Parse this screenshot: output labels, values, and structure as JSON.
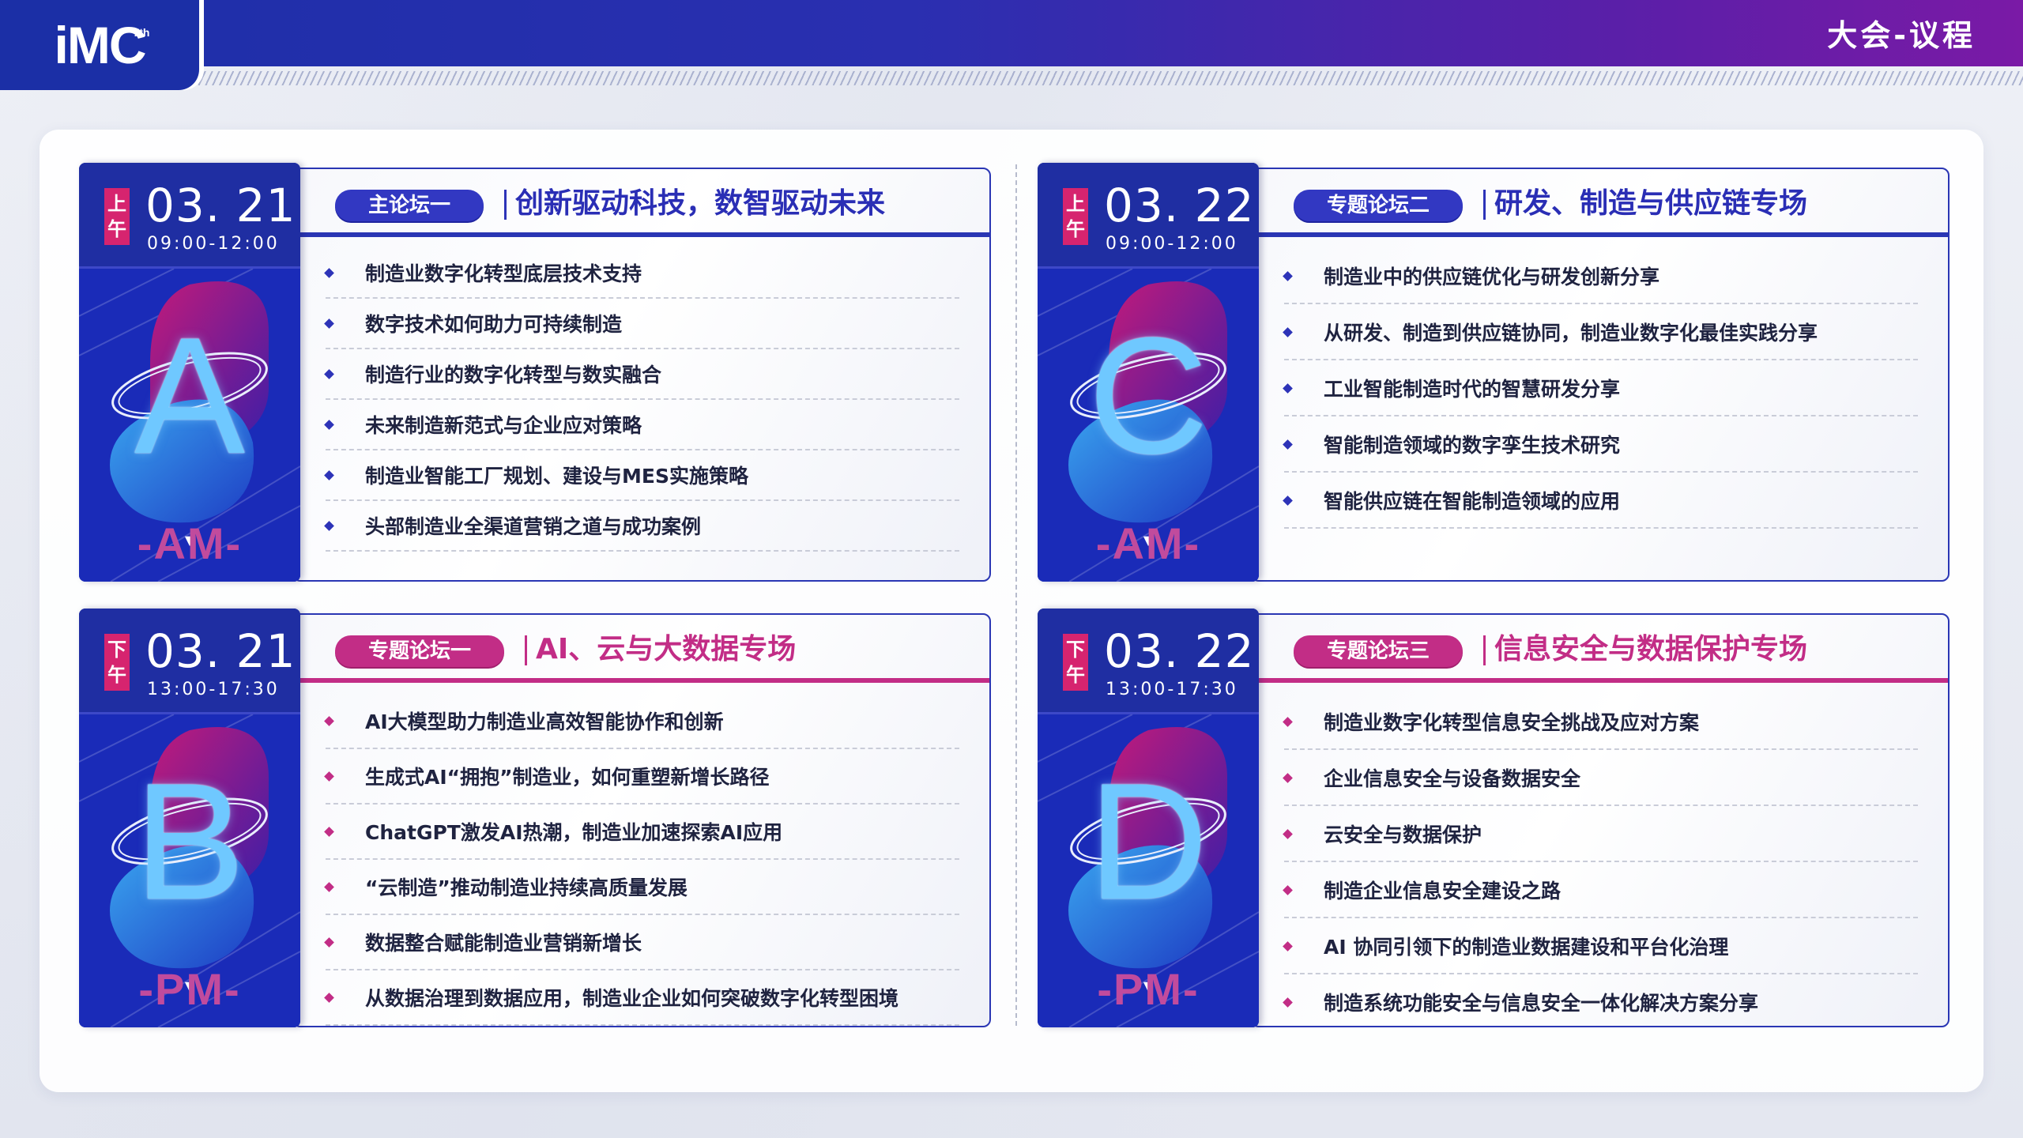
{
  "header": {
    "logo_text": "iMC",
    "logo_sup": "7th",
    "title": "大会-议程"
  },
  "colors": {
    "blue": "#2a36b4",
    "pink": "#c22d86",
    "side": "#1a2bb8",
    "ampm_badge": "#d6246f"
  },
  "sessions": [
    {
      "ampm_l1": "上",
      "ampm_l2": "午",
      "date": "03. 21",
      "time": "09:00-12:00",
      "letter": "A",
      "suffix": "-AM-",
      "arrow": "▼",
      "tag": "主论坛一",
      "title": "创新驱动科技，数智驱动未来",
      "accent": "blue",
      "items": [
        "制造业数字化转型底层技术支持",
        "数字技术如何助力可持续制造",
        "制造行业的数字化转型与数实融合",
        "未来制造新范式与企业应对策略",
        "制造业智能工厂规划、建设与MES实施策略",
        "头部制造业全渠道营销之道与成功案例"
      ]
    },
    {
      "ampm_l1": "上",
      "ampm_l2": "午",
      "date": "03. 22",
      "time": "09:00-12:00",
      "letter": "C",
      "suffix": "-AM-",
      "arrow": "▼",
      "tag": "专题论坛二",
      "title": "研发、制造与供应链专场",
      "accent": "blue",
      "items": [
        "制造业中的供应链优化与研发创新分享",
        "从研发、制造到供应链协同，制造业数字化最佳实践分享",
        "工业智能制造时代的智慧研发分享",
        "智能制造领域的数字孪生技术研究",
        "智能供应链在智能制造领域的应用"
      ]
    },
    {
      "ampm_l1": "下",
      "ampm_l2": "午",
      "date": "03. 21",
      "time": "13:00-17:30",
      "letter": "B",
      "suffix": "-PM-",
      "arrow": "▼",
      "tag": "专题论坛一",
      "title": "AI、云与大数据专场",
      "accent": "pink",
      "items": [
        "AI大模型助力制造业高效智能协作和创新",
        "生成式AI“拥抱”制造业，如何重塑新增长路径",
        "ChatGPT激发AI热潮，制造业加速探索AI应用",
        "“云制造”推动制造业持续高质量发展",
        "数据整合赋能制造业营销新增长",
        "从数据治理到数据应用，制造业企业如何突破数字化转型困境"
      ]
    },
    {
      "ampm_l1": "下",
      "ampm_l2": "午",
      "date": "03. 22",
      "time": "13:00-17:30",
      "letter": "D",
      "suffix": "-PM-",
      "arrow": "▼",
      "tag": "专题论坛三",
      "title": "信息安全与数据保护专场",
      "accent": "pink",
      "items": [
        "制造业数字化转型信息安全挑战及应对方案",
        "企业信息安全与设备数据安全",
        "云安全与数据保护",
        "制造企业信息安全建设之路",
        "AI 协同引领下的制造业数据建设和平台化治理",
        "制造系统功能安全与信息安全一体化解决方案分享"
      ]
    }
  ]
}
